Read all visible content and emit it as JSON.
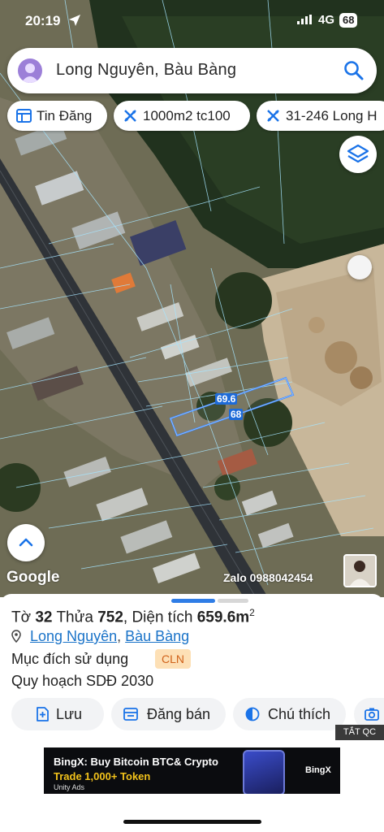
{
  "status_bar": {
    "time": "20:19",
    "network": "4G",
    "battery": "68"
  },
  "search": {
    "query": "Long Nguyên, Bàu Bàng"
  },
  "chips": [
    {
      "label": "Tin Đăng",
      "icon": "listing-icon"
    },
    {
      "label": "1000m2 tc100",
      "icon": "plan-icon"
    },
    {
      "label": "31-246 Long H",
      "icon": "plan-icon"
    }
  ],
  "map": {
    "measure_long": "69.6",
    "measure_short": "68",
    "google_label": "Google",
    "zalo_label": "Zalo 0988042454",
    "colors": {
      "parcel_outline": "#3d8bff",
      "highlight": "#1e6bd8"
    }
  },
  "parcel": {
    "sheet_label": "Tờ",
    "sheet_no": "32",
    "lot_label": "Thửa",
    "lot_no": "752",
    "area_label": "Diện tích",
    "area_value": "659.6m",
    "area_unit_sup": "2",
    "ward": "Long Nguyên",
    "district": "Bàu Bàng",
    "purpose_label": "Mục đích sử dụng",
    "purpose_code": "CLN",
    "plan_label": "Quy hoạch SDĐ 2030"
  },
  "actions": [
    {
      "label": "Lưu",
      "icon": "save-icon"
    },
    {
      "label": "Đăng bán",
      "icon": "post-sale-icon"
    },
    {
      "label": "Chú thích",
      "icon": "legend-icon"
    }
  ],
  "ad": {
    "close_label": "TẮT QC",
    "line1": "BingX: Buy Bitcoin BTC& Crypto",
    "line2": "Trade 1,000+ Token",
    "line3": "Unity Ads",
    "brand": "BingX"
  }
}
